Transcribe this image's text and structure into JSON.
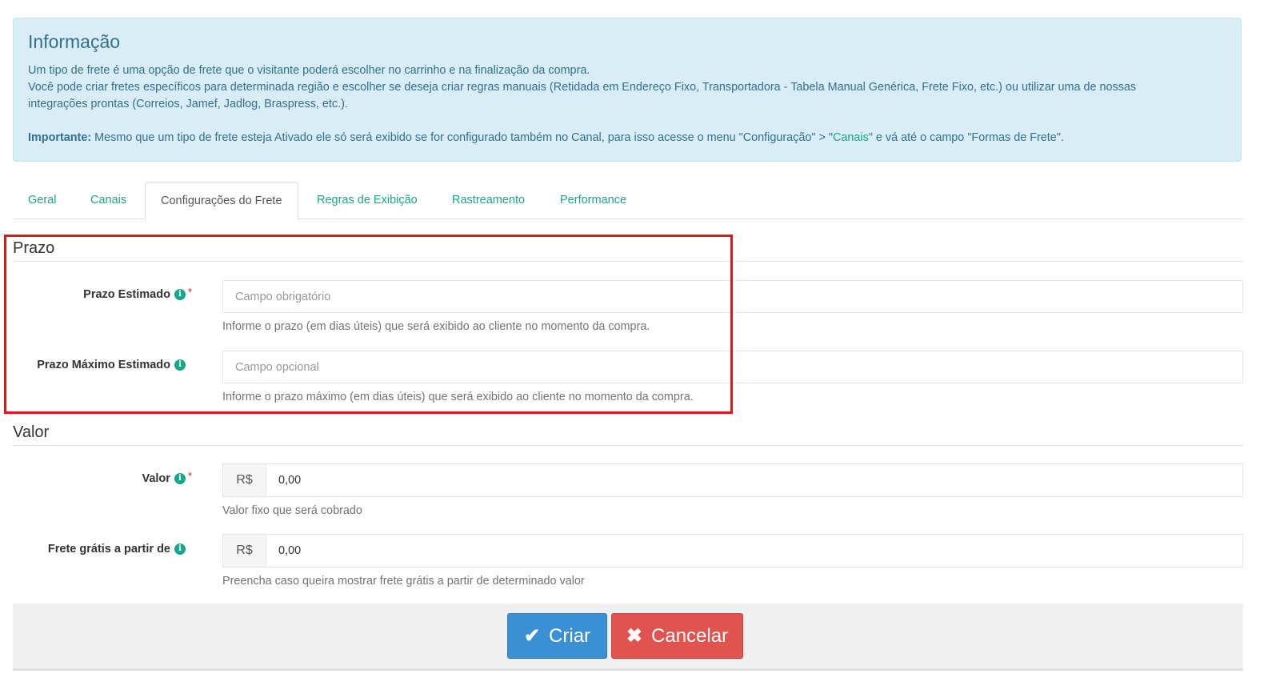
{
  "info": {
    "title": "Informação",
    "line1": "Um tipo de frete é uma opção de frete que o visitante poderá escolher no carrinho e na finalização da compra.",
    "line2": "Você pode criar fretes específicos para determinada região e escolher se deseja criar regras manuais (Retidada em Endereço Fixo, Transportadora - Tabela Manual Genérica, Frete Fixo, etc.) ou utilizar uma de nossas",
    "line3": "integrações prontas (Correios, Jamef, Jadlog, Braspress, etc.).",
    "important_label": "Importante:",
    "important_text_a": " Mesmo que um tipo de frete esteja Ativado ele só será exibido se for configurado também no Canal, para isso acesse o menu \"Configuração\" > \"",
    "important_link": "Canais",
    "important_text_b": "\" e vá até o campo \"Formas de Frete\"."
  },
  "tabs": [
    "Geral",
    "Canais",
    "Configurações do Frete",
    "Regras de Exibição",
    "Rastreamento",
    "Performance"
  ],
  "active_tab": "Configurações do Frete",
  "prazo": {
    "section_title": "Prazo",
    "estimado_label": "Prazo Estimado",
    "estimado_placeholder": "Campo obrigatório",
    "estimado_help": "Informe o prazo (em dias úteis) que será exibido ao cliente no momento da compra.",
    "maximo_label": "Prazo Máximo Estimado",
    "maximo_placeholder": "Campo opcional",
    "maximo_help": "Informe o prazo máximo (em dias úteis) que será exibido ao cliente no momento da compra."
  },
  "valor": {
    "section_title": "Valor",
    "valor_label": "Valor",
    "currency": "R$",
    "valor_value": "0,00",
    "valor_help": "Valor fixo que será cobrado",
    "gratis_label": "Frete grátis a partir de",
    "gratis_value": "0,00",
    "gratis_help": "Preencha caso queira mostrar frete grátis a partir de determinado valor"
  },
  "required_mark": "*",
  "info_icon_glyph": "i",
  "buttons": {
    "create_label": "Criar",
    "create_icon": "✔",
    "cancel_label": "Cancelar",
    "cancel_icon": "✖"
  },
  "colors": {
    "accent": "#18a689",
    "info_bg": "#d9edf7",
    "info_text": "#31708f",
    "primary_button": "#3b8fd3",
    "danger_button": "#e0534f",
    "highlight_border": "#ee1111"
  }
}
